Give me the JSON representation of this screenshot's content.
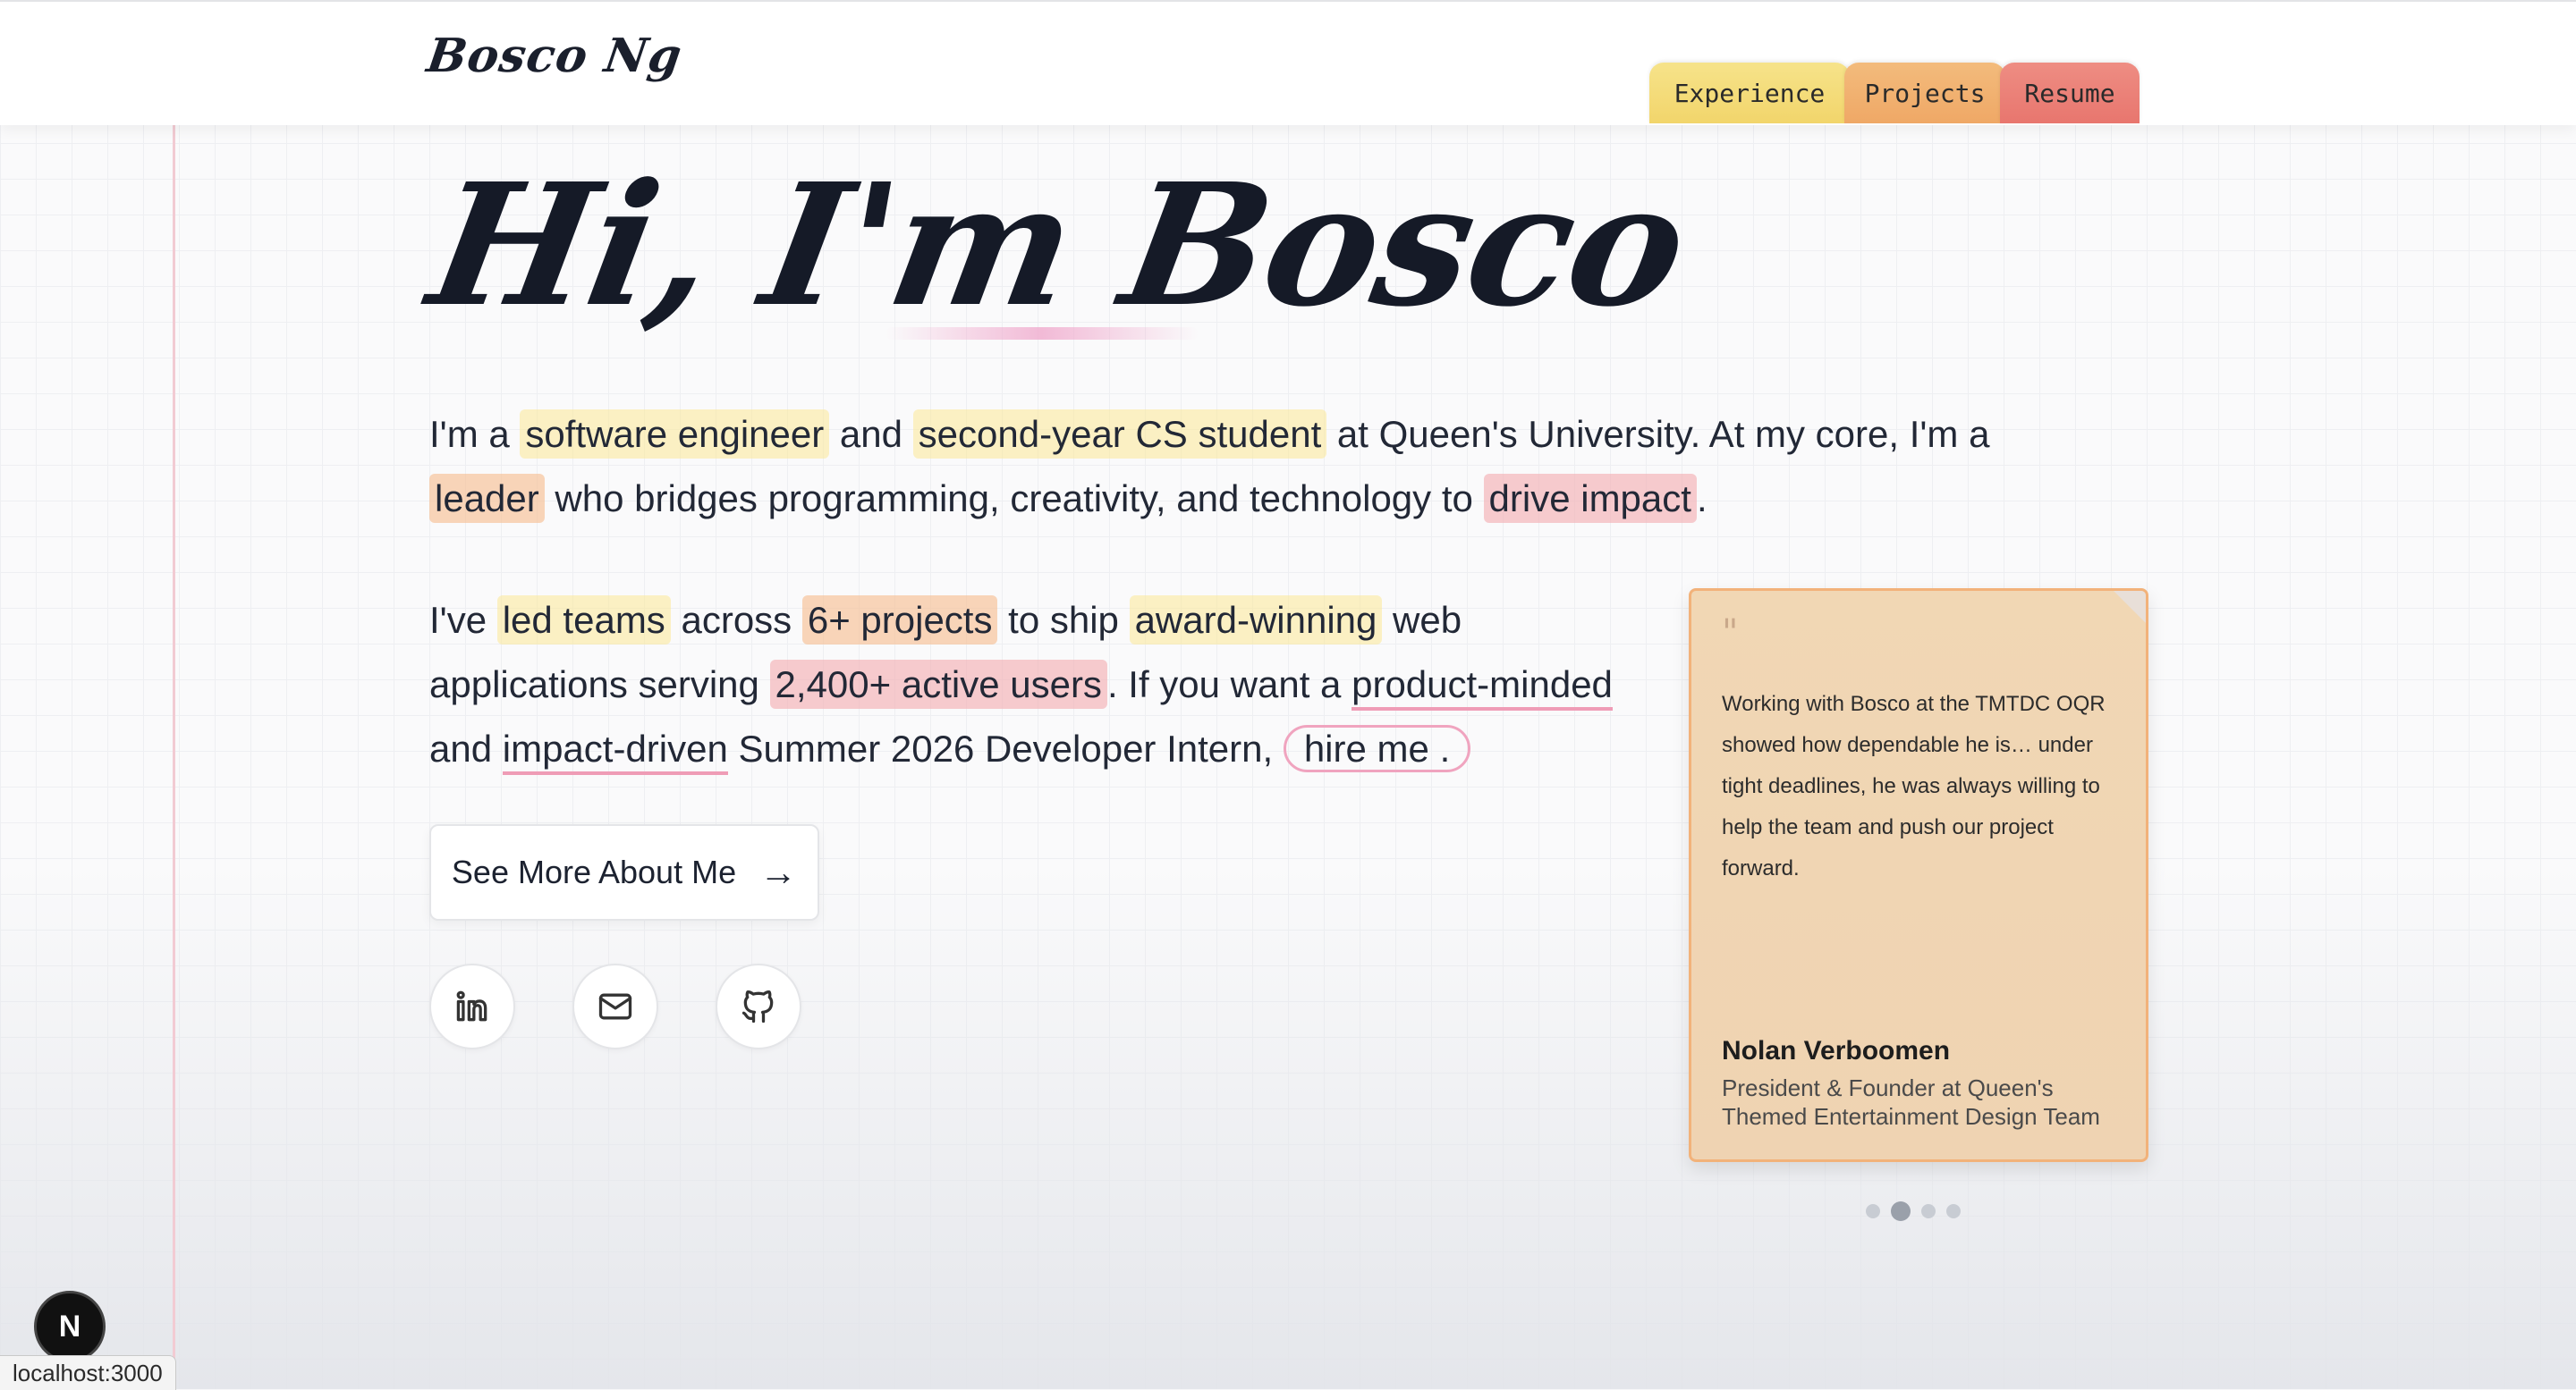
{
  "header": {
    "brand": "Bosco Ng",
    "tabs": [
      {
        "label": "Experience",
        "color": "#f4dc7a"
      },
      {
        "label": "Projects",
        "color": "#f1b172"
      },
      {
        "label": "Resume",
        "color": "#ea8078"
      }
    ]
  },
  "hero": {
    "title": "Hi, I'm Bosco",
    "para1": {
      "t1": "I'm a ",
      "h1": "software engineer",
      "t2": " and ",
      "h2": "second-year CS student",
      "t3": " at Queen's University. At my core, I'm a ",
      "h3": "leader",
      "t4": " who bridges programming, creativity, and technology to ",
      "h4": "drive impact",
      "t5": "."
    },
    "para2": {
      "t1": "I've ",
      "h1": "led teams",
      "t2": " across ",
      "h2": "6+ projects",
      "t3": " to ship ",
      "h3": "award-winning",
      "t4": " web applications serving ",
      "h4": "2,400+ active users",
      "t5": ". If you want a ",
      "u1": "product-minded",
      "t6": " and ",
      "u2": "impact-driven",
      "t7": " Summer 2026 Developer Intern, ",
      "c1": "hire me",
      "t8": "."
    },
    "see_more_label": "See More About Me",
    "see_more_arrow": "→"
  },
  "social": [
    {
      "name": "linkedin-icon"
    },
    {
      "name": "mail-icon"
    },
    {
      "name": "github-icon"
    }
  ],
  "testimonial": {
    "quote_mark": "\"",
    "text": "Working with Bosco at the TMTDC OQR showed how dependable he is… under tight deadlines, he was always willing to help the team and push our project forward.",
    "name": "Nolan Verboomen",
    "role": "President & Founder at Queen's Themed Entertainment Design Team",
    "carousel_total": 4,
    "carousel_active": 2
  },
  "next_badge": "N",
  "status_url": "localhost:3000"
}
